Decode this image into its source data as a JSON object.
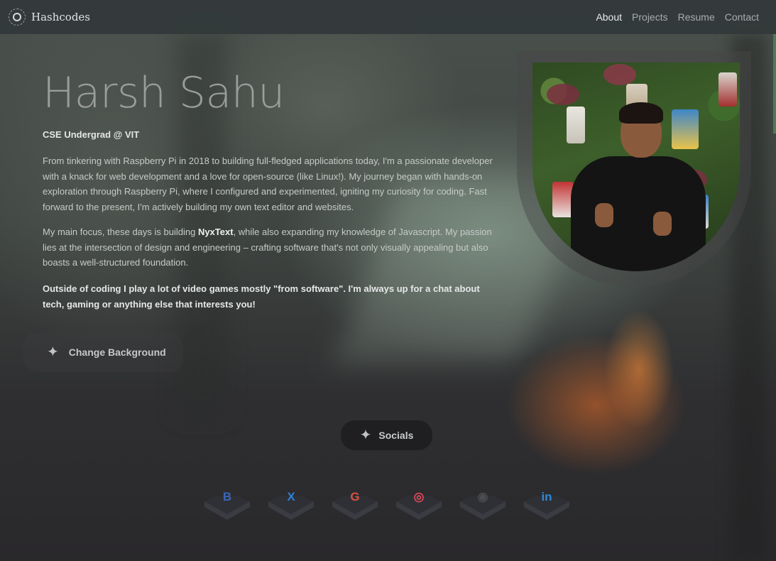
{
  "nav": {
    "brand": "Hashcodes",
    "links": [
      {
        "label": "About",
        "active": true
      },
      {
        "label": "Projects",
        "active": false
      },
      {
        "label": "Resume",
        "active": false
      },
      {
        "label": "Contact",
        "active": false
      }
    ]
  },
  "hero": {
    "name": "Harsh Sahu",
    "subtitle": "CSE Undergrad @ VIT",
    "paragraph1": "From tinkering with Raspberry Pi in 2018 to building full-fledged applications today, I'm a passionate developer with a knack for web development and a love for open-source (like Linux!). My journey began with hands-on exploration through Raspberry Pi, where I configured and experimented, igniting my curiosity for coding. Fast forward to the present, I'm actively building my own text editor and websites.",
    "paragraph2_before": "My main focus, these days is building ",
    "paragraph2_highlight": "NyxText",
    "paragraph2_after": ", while also expanding my knowledge of Javascript. My passion lies at the intersection of design and engineering – crafting software that's not only visually appealing but also boasts a well-structured foundation.",
    "paragraph3": "Outside of coding I play a lot of video games mostly \"from software\". I'm always up for a chat about tech, gaming or anything else that interests you!",
    "change_background_label": "Change Background"
  },
  "socials": {
    "label": "Socials",
    "items": [
      {
        "name": "bluesky",
        "glyph": "B",
        "color": "#3b66b8"
      },
      {
        "name": "x",
        "glyph": "X",
        "color": "#2f7fd6"
      },
      {
        "name": "google",
        "glyph": "G",
        "color": "#d9503f"
      },
      {
        "name": "instagram",
        "glyph": "◎",
        "color": "#e0485a"
      },
      {
        "name": "github",
        "glyph": "◉",
        "color": "#4a4c50"
      },
      {
        "name": "linkedin",
        "glyph": "in",
        "color": "#2f86d8"
      }
    ]
  },
  "colors": {
    "nav_bg": "#323a3a",
    "accent_scroll": "#4f7a55"
  }
}
